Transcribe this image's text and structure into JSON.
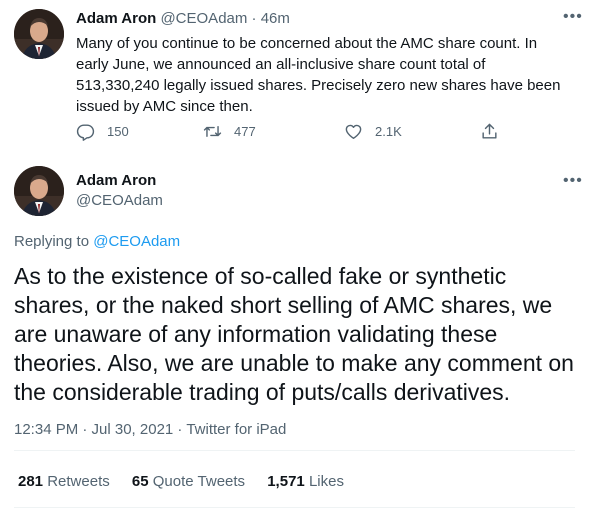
{
  "tweet1": {
    "author_name": "Adam Aron",
    "author_handle": "@CEOAdam",
    "separator": "·",
    "time": "46m",
    "more_icon": "more-dots-icon",
    "text": "Many of you continue to be concerned about the AMC share count. In early June, we announced an all-inclusive share count total of 513,330,240 legally issued shares. Precisely zero new shares have been issued by AMC since then.",
    "actions": {
      "reply_count": "150",
      "retweet_count": "477",
      "like_count": "2.1K"
    }
  },
  "tweet2": {
    "author_name": "Adam Aron",
    "author_handle": "@CEOAdam",
    "more_icon": "more-dots-icon",
    "replying_prefix": "Replying to ",
    "replying_handle": "@CEOAdam",
    "text": "As to the existence of so-called fake or synthetic shares, or the naked short selling of AMC shares, we are unaware of any information validating these theories. Also, we are unable to make any comment on the considerable trading of puts/calls derivatives.",
    "timestamp": "12:34 PM · Jul 30, 2021",
    "meta_separator": " · ",
    "source": "Twitter for iPad",
    "stats": {
      "retweets_count": "281",
      "retweets_label": "Retweets",
      "quote_count": "65",
      "quote_label": "Quote Tweets",
      "likes_count": "1,571",
      "likes_label": "Likes"
    }
  },
  "colors": {
    "accent": "#1d9bf0",
    "secondary_text": "#536471",
    "primary_text": "#0f1419"
  }
}
